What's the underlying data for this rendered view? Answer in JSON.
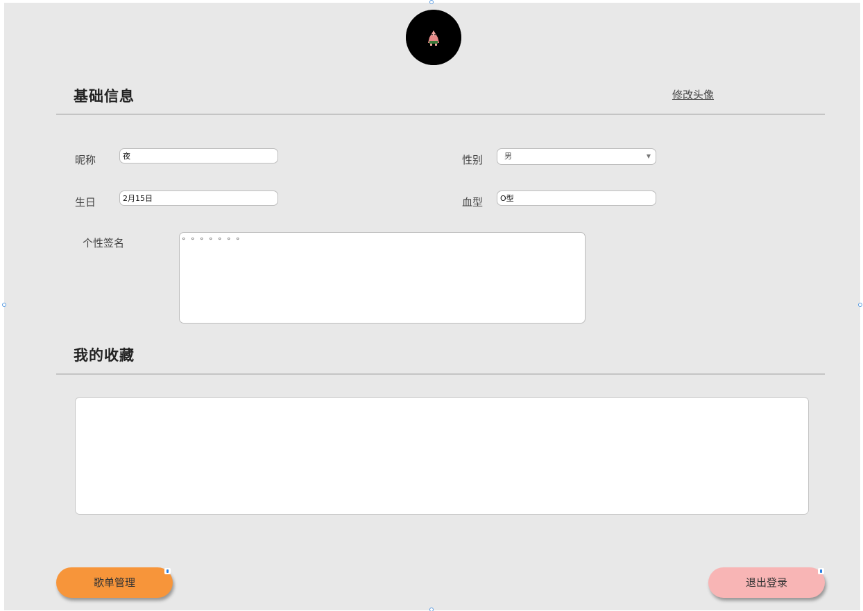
{
  "profile": {
    "avatar_icon": "avatar-image"
  },
  "basic_info": {
    "title": "基础信息",
    "change_avatar": "修改头像",
    "nickname_label": "昵称",
    "nickname_value": "夜",
    "gender_label": "性别",
    "gender_value": "男",
    "birthday_label": "生日",
    "birthday_value": "2月15日",
    "blood_label": "血型",
    "blood_value": "O型",
    "signature_label": "个性签名",
    "signature_value": "° ° ° ° ° ° °"
  },
  "favorites": {
    "title": "我的收藏"
  },
  "buttons": {
    "playlist_manage": "歌单管理",
    "logout": "退出登录"
  },
  "colors": {
    "page_background": "#e8e8e8",
    "playlist_button": "#f7953a",
    "logout_button": "#f8b5b5"
  }
}
